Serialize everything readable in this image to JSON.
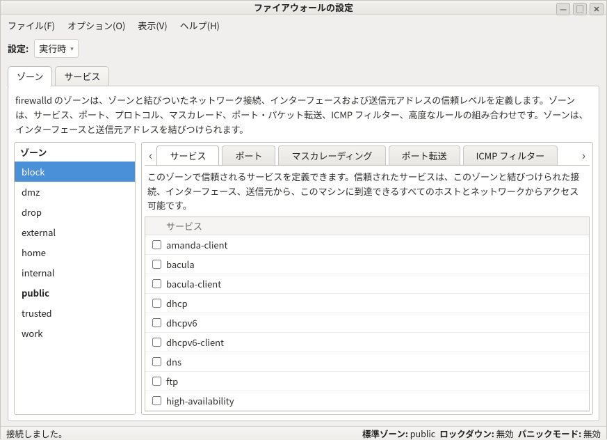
{
  "window": {
    "title": "ファイアウォールの設定"
  },
  "menu": {
    "file": "ファイル(F)",
    "option": "オプション(O)",
    "view": "表示(V)",
    "help": "ヘルプ(H)"
  },
  "config": {
    "label": "設定:",
    "value": "実行時"
  },
  "outer_tabs": {
    "zones": "ゾーン",
    "services": "サービス"
  },
  "zone_desc": "firewalld のゾーンは、ゾーンと結びついたネットワーク接続、インターフェースおよび送信元アドレスの信頼レベルを定義します。ゾーンは、サービス、ポート、プロトコル、マスカレード、ポート・パケット転送、ICMP フィルター、高度なルールの組み合わせです。ゾーンは、インターフェースと送信元アドレスを結びつけられます。",
  "zone_header": "ゾーン",
  "zones": [
    {
      "name": "block",
      "selected": true,
      "bold": false
    },
    {
      "name": "dmz",
      "selected": false,
      "bold": false
    },
    {
      "name": "drop",
      "selected": false,
      "bold": false
    },
    {
      "name": "external",
      "selected": false,
      "bold": false
    },
    {
      "name": "home",
      "selected": false,
      "bold": false
    },
    {
      "name": "internal",
      "selected": false,
      "bold": false
    },
    {
      "name": "public",
      "selected": false,
      "bold": true
    },
    {
      "name": "trusted",
      "selected": false,
      "bold": false
    },
    {
      "name": "work",
      "selected": false,
      "bold": false
    }
  ],
  "inner_tabs": {
    "services": "サービス",
    "ports": "ポート",
    "masquerade": "マスカレーディング",
    "forward": "ポート転送",
    "icmp": "ICMP フィルター"
  },
  "inner_desc": "このゾーンで信頼されるサービスを定義できます。信頼されたサービスは、このゾーンと結びつけられた接続、インターフェース、送信元から、このマシンに到達できるすべてのホストとネットワークからアクセス可能です。",
  "service_header": "サービス",
  "services": [
    "amanda-client",
    "bacula",
    "bacula-client",
    "dhcp",
    "dhcpv6",
    "dhcpv6-client",
    "dns",
    "ftp",
    "high-availability"
  ],
  "status": {
    "connected": "接続しました。",
    "default_zone_label": "標準ゾーン:",
    "default_zone_value": "public",
    "lockdown_label": "ロックダウン:",
    "lockdown_value": "無効",
    "panic_label": "パニックモード:",
    "panic_value": "無効"
  }
}
